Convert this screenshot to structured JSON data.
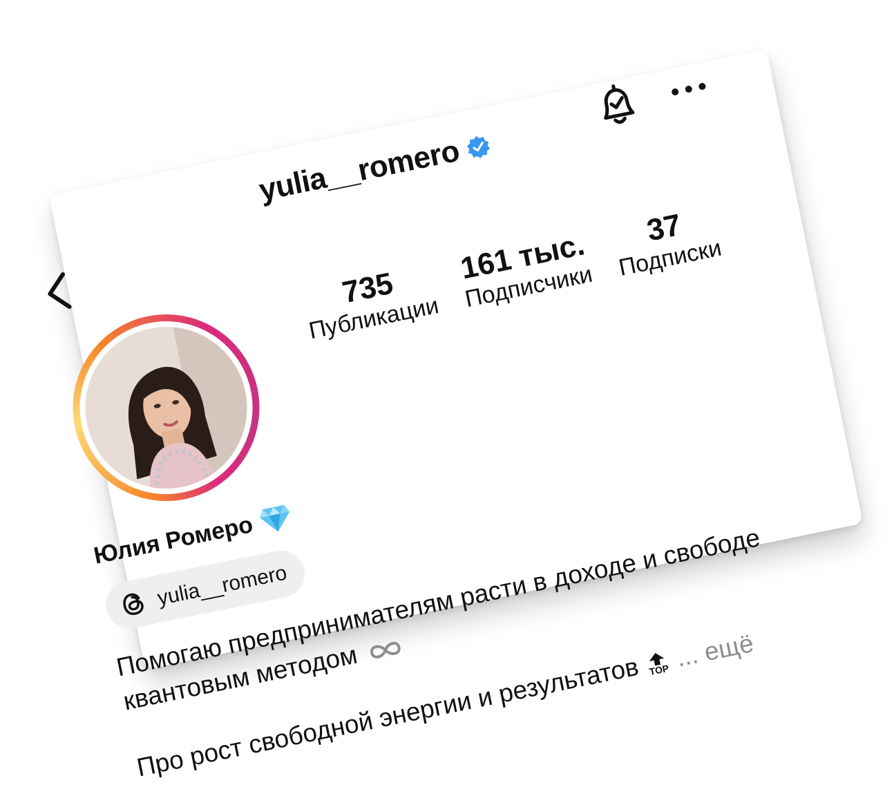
{
  "header": {
    "username": "yulia__romero"
  },
  "stats": [
    {
      "value": "735",
      "label": "Публикации"
    },
    {
      "value": "161 тыс.",
      "label": "Подписчики"
    },
    {
      "value": "37",
      "label": "Подписки"
    }
  ],
  "profile": {
    "full_name": "Юлия Ромеро",
    "threads_handle": "yulia__romero"
  },
  "bio": {
    "line1": "Помогаю предпринимателям расти в доходе и свободе",
    "line2": "квантовым методом",
    "line3": "Про рост свободной энергии и результатов",
    "top_emoji_label": "TOP",
    "ellipsis": "...",
    "more": "ещё"
  },
  "colors": {
    "verified": "#3897f0",
    "accent_ring": "#dd2a7b",
    "muted": "#8e8e8e"
  },
  "icons": [
    "back-arrow-icon",
    "verified-badge-icon",
    "notification-bell-icon",
    "more-options-icon",
    "diamond-icon",
    "threads-icon",
    "infinity-icon",
    "top-arrow-icon"
  ]
}
